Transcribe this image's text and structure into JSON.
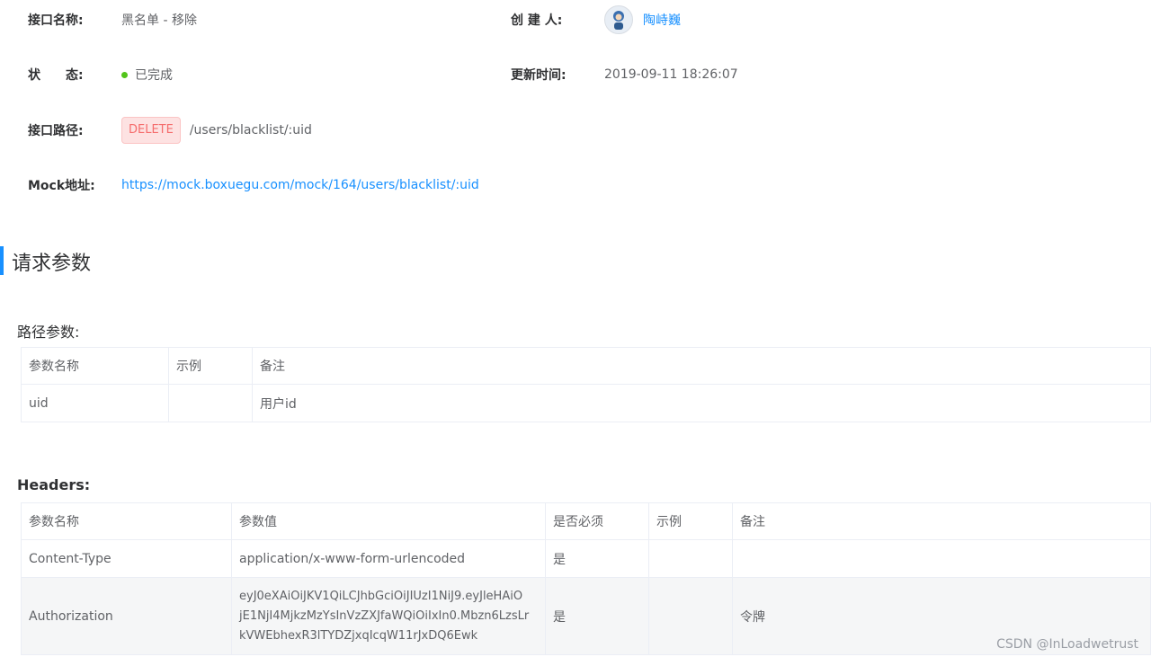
{
  "interface": {
    "name_label": "接口名称:",
    "name_value": "黑名单 - 移除",
    "status_label": "状　　态:",
    "status_value": "已完成",
    "path_label": "接口路径:",
    "method": "DELETE",
    "path": "/users/blacklist/:uid",
    "mock_label": "Mock地址:",
    "mock_url": "https://mock.boxuegu.com/mock/164/users/blacklist/:uid",
    "creator_label": "创 建 人:",
    "creator_name": "陶峙巍",
    "updated_label": "更新时间:",
    "updated_value": "2019-09-11 18:26:07"
  },
  "section_title": "请求参数",
  "path_params": {
    "title": "路径参数:",
    "headers": [
      "参数名称",
      "示例",
      "备注"
    ],
    "rows": [
      {
        "name": "uid",
        "example": "",
        "note": "用户id"
      }
    ]
  },
  "headers_params": {
    "title": "Headers:",
    "headers": [
      "参数名称",
      "参数值",
      "是否必须",
      "示例",
      "备注"
    ],
    "rows": [
      {
        "name": "Content-Type",
        "value_lines": [
          "application/x-www-form-urlencoded"
        ],
        "required": "是",
        "example": "",
        "note": ""
      },
      {
        "name": "Authorization",
        "value_lines": [
          "eyJ0eXAiOiJKV1QiLCJhbGciOiJIUzI1NiJ9.eyJleHAiO",
          "jE1NjI4MjkzMzYsInVzZXJfaWQiOiIxIn0.Mbzn6LzsLr",
          "kVWEbhexR3lTYDZjxqIcqW11rJxDQ6Ewk"
        ],
        "required": "是",
        "example": "",
        "note": "令牌"
      }
    ]
  },
  "watermark": "CSDN @InLoadwetrust",
  "colors": {
    "accent": "#1890ff",
    "status_ok": "#52c41a",
    "method_delete": "#f56c6c"
  }
}
